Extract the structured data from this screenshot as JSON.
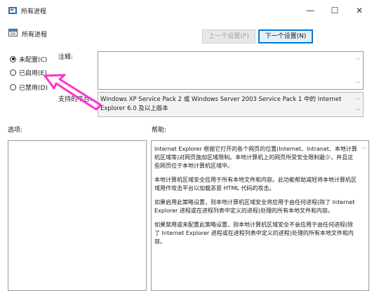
{
  "window": {
    "title": "所有进程",
    "minimize_glyph": "—",
    "maximize_glyph": "☐",
    "close_glyph": "✕"
  },
  "header": {
    "policy_title": "所有进程",
    "prev_button": "上一个设置(P)",
    "next_button": "下一个设置(N)"
  },
  "state": {
    "options": [
      {
        "label": "未配置(C)",
        "checked": true
      },
      {
        "label": "已启用(E)",
        "checked": false
      },
      {
        "label": "已禁用(D)",
        "checked": false
      }
    ]
  },
  "comment": {
    "label": "注释:"
  },
  "supported": {
    "label": "支持的平台:",
    "value": "Windows XP Service Pack 2 或 Windows Server 2003 Service Pack 1 中的 Internet Explorer 6.0 及以上版本"
  },
  "options_panel": {
    "label": "选项:"
  },
  "help_panel": {
    "label": "帮助:",
    "paragraphs": [
      "Internet Explorer 根据它打开的各个网页的位置(Internet、Intranet、本地计算机区域等)对网页施加区域限制。本地计算机上的网页所受安全限制最少，并且这些网页位于本地计算机区域中。",
      "本地计算机区域安全应用于所有本地文件和内容。此功能帮助减轻将本地计算机区域用作攻击平台以加载恶意 HTML 代码的攻击。",
      "如果启用此策略设置，则本地计算机区域安全将应用于由任何进程(除了 Internet Explorer 进程或在进程列表中定义的进程)处理的所有本地文件和内容。",
      "如果禁用或未配置此策略设置，则本地计算机区域安全不会应用于由任何进程(除了 Internet Explorer 进程或在进程列表中定义的进程)处理的所有本地文件和内容。"
    ]
  },
  "colors": {
    "annotation_arrow": "#ff33cc",
    "focus_border": "#0078d7"
  }
}
